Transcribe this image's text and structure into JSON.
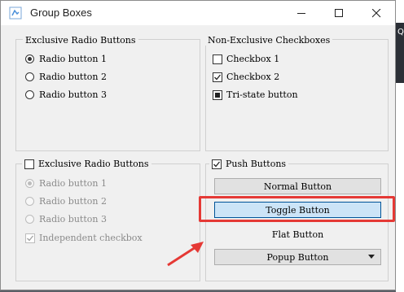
{
  "window": {
    "title": "Group Boxes"
  },
  "background": {
    "partial_text": "Q"
  },
  "radio_group": {
    "title": "Exclusive Radio Buttons",
    "options": [
      {
        "label": "Radio button 1",
        "checked": true
      },
      {
        "label": "Radio button 2",
        "checked": false
      },
      {
        "label": "Radio button 3",
        "checked": false
      }
    ]
  },
  "checkbox_group": {
    "title": "Non-Exclusive Checkboxes",
    "options": [
      {
        "label": "Checkbox 1",
        "state": "unchecked"
      },
      {
        "label": "Checkbox 2",
        "state": "checked"
      },
      {
        "label": "Tri-state button",
        "state": "partial"
      }
    ]
  },
  "checkable_radio_group": {
    "title": "Exclusive Radio Buttons",
    "checked": false,
    "options": [
      {
        "label": "Radio button 1",
        "checked": true
      },
      {
        "label": "Radio button 2",
        "checked": false
      },
      {
        "label": "Radio button 3",
        "checked": false
      }
    ],
    "independent_checkbox": {
      "label": "Independent checkbox",
      "checked": true
    }
  },
  "push_buttons_group": {
    "title": "Push Buttons",
    "checked": true,
    "normal_button": "Normal Button",
    "toggle_button": "Toggle Button",
    "flat_button": "Flat Button",
    "popup_button": "Popup Button"
  },
  "annotation": {
    "color": "#e53935"
  }
}
